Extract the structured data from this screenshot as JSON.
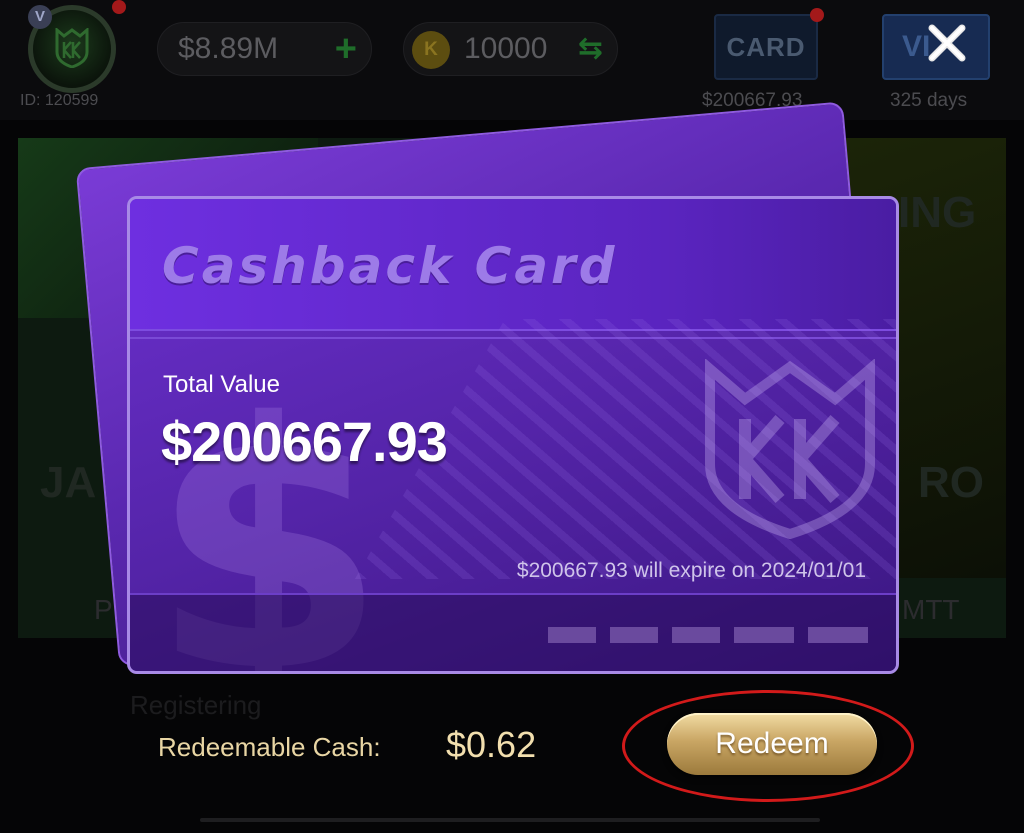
{
  "topbar": {
    "id_label": "ID: 120599",
    "balance": "$8.89M",
    "balance_add": "+",
    "coin_symbol": "K",
    "coins": "10000",
    "coins_swap": "⇆",
    "card_button": "CARD",
    "card_value": "$200667.93",
    "vip_text": "VI",
    "vip_days": "325 days",
    "avatar_badge": "V"
  },
  "background": {
    "ghost_left": "JA",
    "ghost_right": "RO",
    "ghost_top_right": "ING",
    "tab_left": "PL",
    "tab_right": "MTT",
    "registering": "Registering"
  },
  "card": {
    "title": "Cashback Card",
    "total_label": "Total Value",
    "total_value": "$200667.93",
    "expire_text": "$200667.93 will expire on 2024/01/01"
  },
  "redeem": {
    "label": "Redeemable Cash:",
    "value": "$0.62",
    "button": "Redeem"
  },
  "colors": {
    "card_purple": "#5a24bf",
    "gold": "#c9a664",
    "highlight": "#d21a1a"
  }
}
